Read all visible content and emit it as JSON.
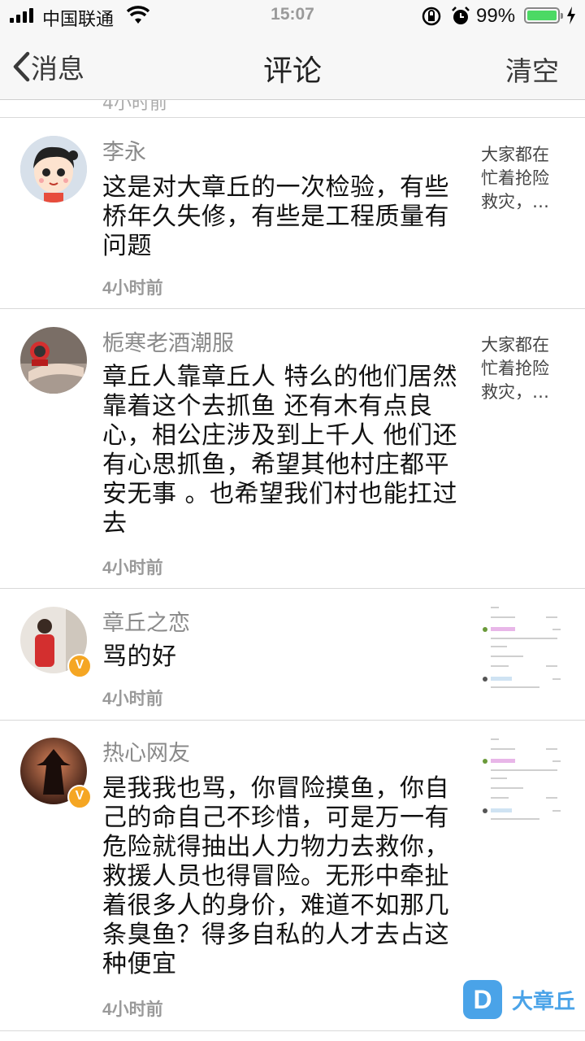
{
  "status_bar": {
    "carrier": "中国联通",
    "time": "15:07",
    "battery_percent": "99%",
    "battery_level": 0.99,
    "icons": [
      "signal-icon",
      "wifi-icon",
      "rotation-lock-icon",
      "alarm-icon",
      "battery-icon",
      "charging-bolt-icon"
    ]
  },
  "navbar": {
    "back_label": "消息",
    "title": "评论",
    "clear_label": "清空"
  },
  "comments": [
    {
      "username": "李永",
      "text": "这是对大章丘的一次检验，有些桥年久失修，有些是工程质量有问题",
      "time": "4小时前",
      "preview": "大家都在忙着抢险救灾，…",
      "verified": false
    },
    {
      "username": "栀寒老酒潮服",
      "text": "章丘人靠章丘人  特么的他们居然靠着这个去抓鱼  还有木有点良心，相公庄涉及到上千人  他们还有心思抓鱼，希望其他村庄都平安无事 。也希望我们村也能扛过去",
      "time": "4小时前",
      "preview": "大家都在忙着抢险救灾，…",
      "verified": false
    },
    {
      "username": "章丘之恋",
      "text": "骂的好",
      "time": "4小时前",
      "preview": "",
      "verified": true
    },
    {
      "username": "热心网友",
      "text": "是我我也骂，你冒险摸鱼，你自己的命自己不珍惜，可是万一有危险就得抽出人力物力去救你，救援人员也得冒险。无形中牵扯着很多人的身价，难道不如那几条臭鱼？得多自私的人才去占这种便宜",
      "time": "4小时前",
      "preview": "",
      "verified": true
    }
  ],
  "watermark": {
    "mark": "D",
    "text": "大章丘"
  },
  "colors": {
    "accent_blue": "#4aa3e8",
    "verified_badge": "#f5a623",
    "battery_green": "#4cd964"
  }
}
